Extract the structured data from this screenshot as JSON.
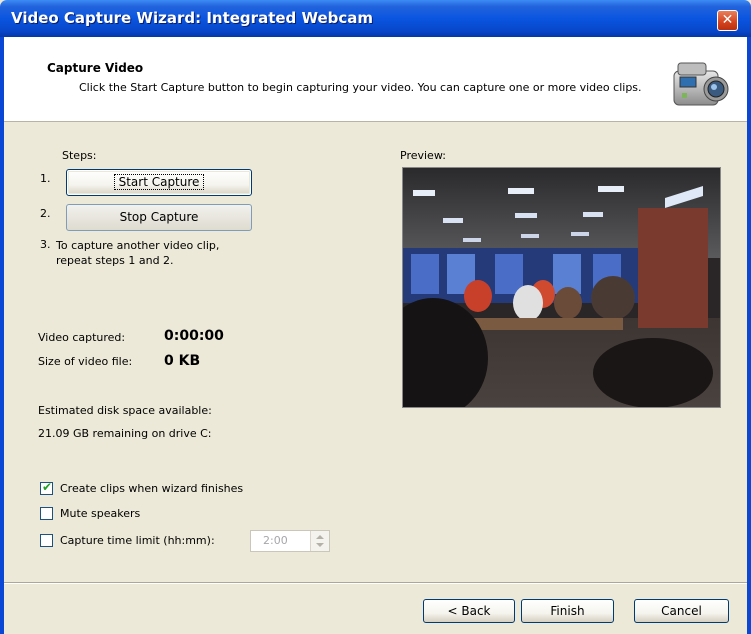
{
  "window": {
    "title": "Video Capture Wizard: Integrated Webcam",
    "close_glyph": "✕"
  },
  "header": {
    "title": "Capture Video",
    "description": "Click the Start Capture button to begin capturing your video. You can capture one or more video clips.",
    "icon": "camcorder-icon"
  },
  "steps": {
    "label": "Steps:",
    "n1": "1.",
    "start_label": "Start Capture",
    "n2": "2.",
    "stop_label": "Stop Capture",
    "n3": "3.",
    "step3_text": "To capture another video clip,\nrepeat steps 1 and 2."
  },
  "preview": {
    "label": "Preview:"
  },
  "stats": {
    "captured_label": "Video captured:",
    "captured_value": "0:00:00",
    "size_label": "Size of video file:",
    "size_value": "0 KB"
  },
  "disk": {
    "label": "Estimated disk space available:",
    "remaining": "21.09 GB remaining on drive C:"
  },
  "options": {
    "create_clips": {
      "label": "Create clips when wizard finishes",
      "checked": true
    },
    "mute": {
      "label": "Mute speakers",
      "checked": false
    },
    "time_limit": {
      "label": "Capture time limit (hh:mm):",
      "checked": false,
      "value": "2:00"
    }
  },
  "footer": {
    "back_label": "< Back",
    "finish_label": "Finish",
    "cancel_label": "Cancel"
  }
}
